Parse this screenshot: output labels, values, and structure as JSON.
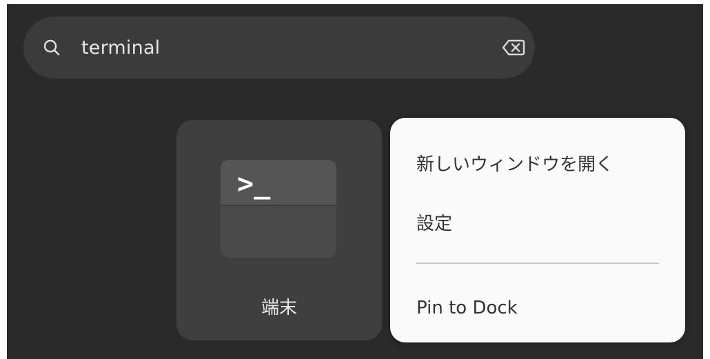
{
  "search": {
    "query": "terminal",
    "search_icon": "search-icon",
    "clear_icon": "backspace-clear-icon"
  },
  "results": [
    {
      "label": "端末",
      "icon": "terminal-icon",
      "icon_glyph": ">_"
    }
  ],
  "context_menu": {
    "items": [
      {
        "label": "新しいウィンドウを開く"
      },
      {
        "label": "設定"
      },
      {
        "label": "Pin to Dock"
      }
    ]
  },
  "colors": {
    "background": "#2a2a2a",
    "search_bar": "#3b3b3b",
    "tile": "#3f3f3f",
    "menu": "#fafafa",
    "menu_text": "#333333",
    "text_light": "#e8e8e8"
  }
}
